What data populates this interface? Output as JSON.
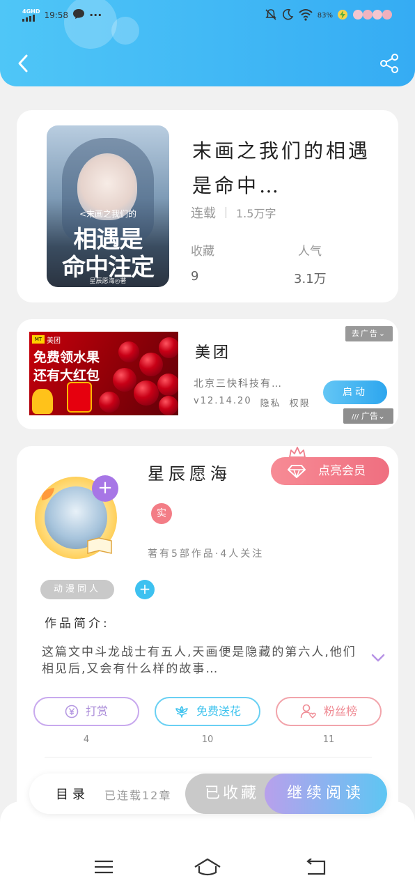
{
  "status_bar": {
    "network": "4GHD",
    "time": "19:58",
    "more": "···",
    "battery": "83%"
  },
  "book": {
    "title": "末画之我们的相遇是命中…",
    "status": "连载",
    "word_count": "1.5万字",
    "favorites_label": "收藏",
    "favorites_value": "9",
    "popularity_label": "人气",
    "popularity_value": "3.1万",
    "cover": {
      "subtitle": "<末画之我们的",
      "title_line1": "相遇是",
      "title_line2": "命中注定",
      "author": "星辰愿海◎著"
    }
  },
  "ad": {
    "image_brand": "美团",
    "image_line1": "免费领水果",
    "image_line2": "还有大红包",
    "title": "美团",
    "company": "北京三快科技有…",
    "version": "v12.14.20",
    "privacy": "隐私",
    "permissions": "权限",
    "launch_label": "启动",
    "remove_label": "去广告",
    "ad_tag": "广告"
  },
  "author": {
    "name": "星辰愿海",
    "real_badge": "实",
    "stats": "著有5部作品·4人关注",
    "vip_label": "点亮会员",
    "tag": "动漫同人",
    "intro_label": "作品简介:",
    "intro_text": "这篇文中斗龙战士有五人,天画便是隐藏的第六人,他们相见后,又会有什么样的故事…",
    "actions": [
      {
        "label": "打赏",
        "count": "4",
        "color": "#b08fe0"
      },
      {
        "label": "免费送花",
        "count": "10",
        "color": "#3fc3ee"
      },
      {
        "label": "粉丝榜",
        "count": "11",
        "color": "#ef8a93"
      }
    ]
  },
  "bottom_bar": {
    "toc_label": "目录",
    "toc_count": "已连载12章",
    "favorited_label": "已收藏",
    "continue_label": "继续阅读"
  },
  "colors": {
    "header": "#35acf3",
    "accent_blue": "#3dc1f0",
    "vip_pink": "#ef6f80",
    "purple": "#a776e6"
  }
}
